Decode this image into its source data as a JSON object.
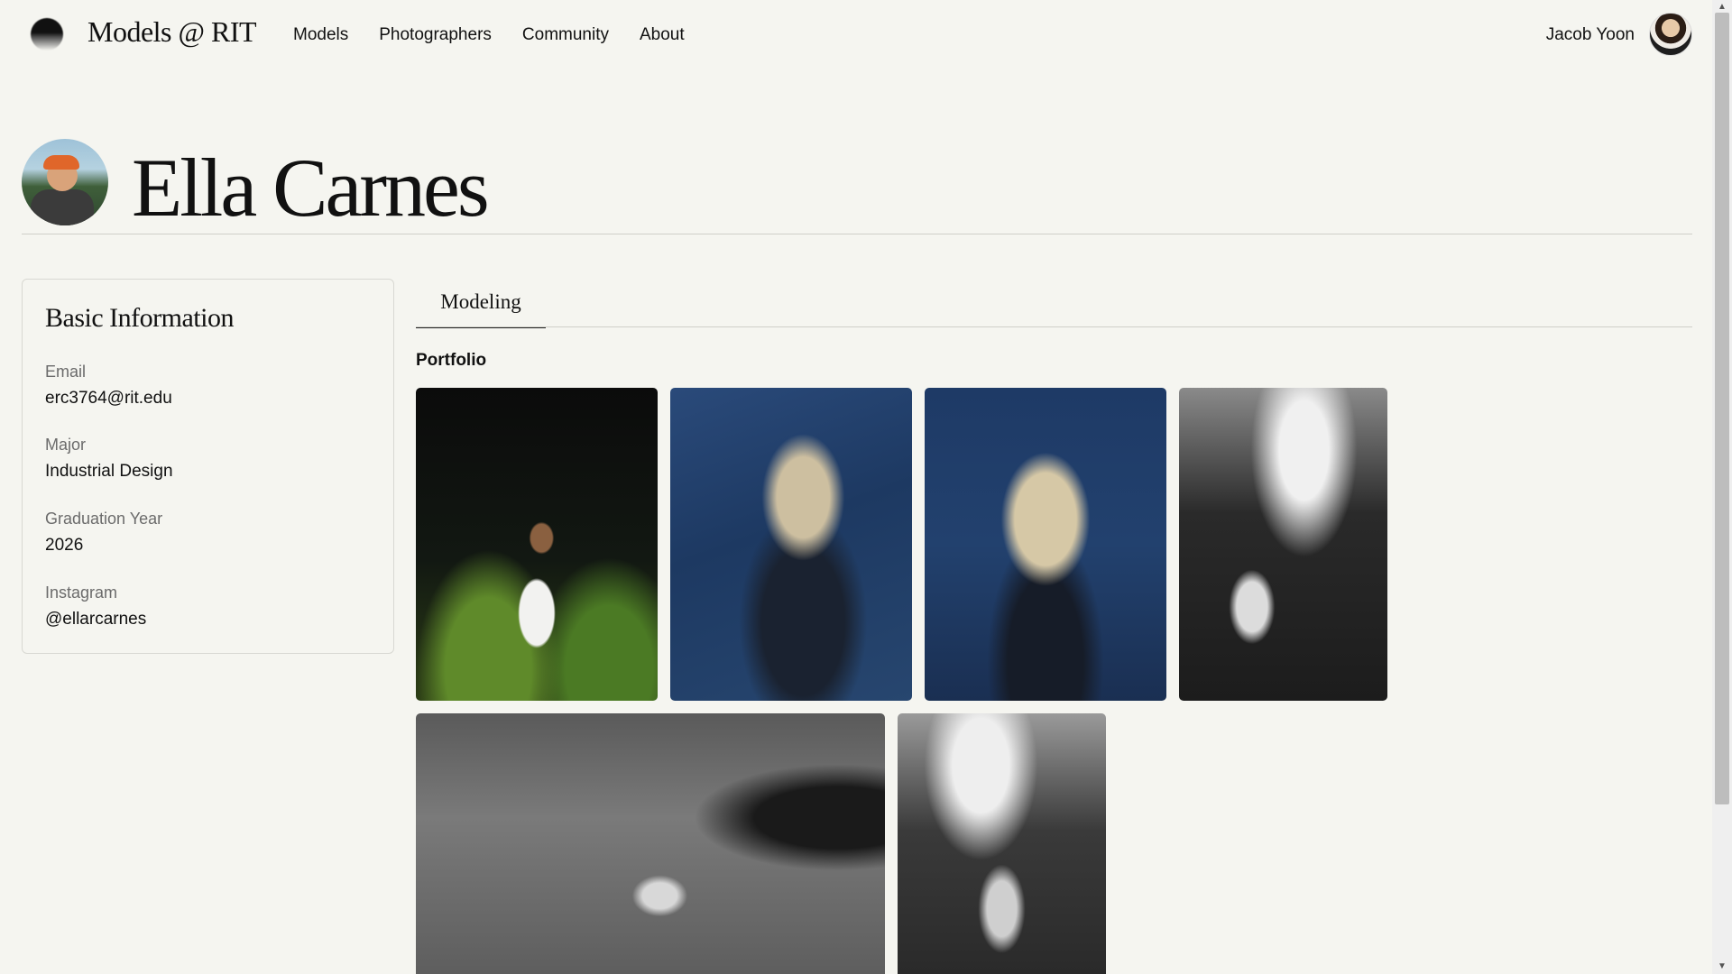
{
  "nav": {
    "brand": "Models @ RIT",
    "links": [
      "Models",
      "Photographers",
      "Community",
      "About"
    ],
    "user_name": "Jacob Yoon"
  },
  "profile": {
    "name": "Ella Carnes"
  },
  "info": {
    "title": "Basic Information",
    "fields": [
      {
        "label": "Email",
        "value": "erc3764@rit.edu"
      },
      {
        "label": "Major",
        "value": "Industrial Design"
      },
      {
        "label": "Graduation Year",
        "value": "2026"
      },
      {
        "label": "Instagram",
        "value": "@ellarcarnes"
      }
    ]
  },
  "tabs": [
    {
      "label": "Modeling",
      "active": true
    }
  ],
  "portfolio": {
    "title": "Portfolio",
    "photo_count": 6
  },
  "colors": {
    "background": "#f5f5f0",
    "text": "#111111",
    "muted": "#6b6b6b",
    "border": "#d8d8d2"
  }
}
